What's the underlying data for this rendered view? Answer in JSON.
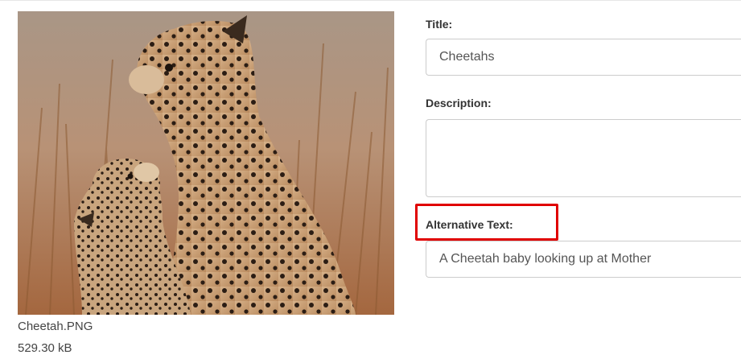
{
  "media": {
    "file_name": "Cheetah.PNG",
    "file_size": "529.30 kB"
  },
  "form": {
    "title": {
      "label": "Title:",
      "value": "Cheetahs"
    },
    "description": {
      "label": "Description:",
      "value": ""
    },
    "alt_text": {
      "label": "Alternative Text:",
      "value": "A Cheetah baby looking up at Mother"
    }
  },
  "colors": {
    "highlight": "#e00000",
    "input_border": "#cccccc",
    "label_text": "#333333"
  }
}
